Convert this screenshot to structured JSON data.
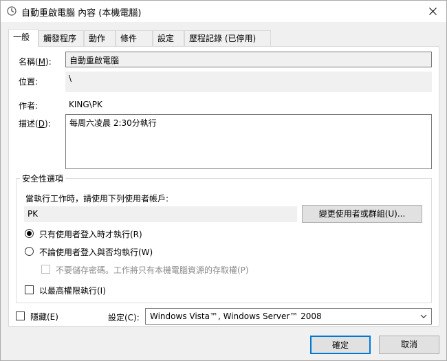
{
  "window": {
    "title": "自動重啟電腦 內容 (本機電腦)"
  },
  "tabs": [
    {
      "label": "一般",
      "accel": "",
      "active": true
    },
    {
      "label": "觸發程序",
      "active": false
    },
    {
      "label": "動作",
      "active": false
    },
    {
      "label": "條件",
      "active": false
    },
    {
      "label": "設定",
      "active": false
    },
    {
      "label": "歷程記錄 (已停用)",
      "active": false
    }
  ],
  "general": {
    "name_label": "名稱(",
    "name_accel": "M",
    "name_label_end": "):",
    "name_value": "自動重啟電腦",
    "location_label": "位置:",
    "location_value": "\\",
    "author_label": "作者:",
    "author_value": "KING\\PK",
    "desc_label": "描述(",
    "desc_accel": "D",
    "desc_label_end": "):",
    "desc_value": "每周六凌晨 2:30分執行"
  },
  "security": {
    "legend": "安全性選項",
    "run_as_label": "當執行工作時，請使用下列使用者帳戶:",
    "user_value": "PK",
    "change_user_button": "變更使用者或群組(U)...",
    "radio_logged_on": "只有使用者登入時才執行(R)",
    "radio_logged_on_selected": true,
    "radio_any": "不論使用者登入與否均執行(W)",
    "radio_any_selected": false,
    "no_store_password": "不要儲存密碼。工作將只有本機電腦資源的存取權(P)",
    "highest_priv": "以最高權限執行(I)"
  },
  "footer": {
    "hidden_label": "隱藏(E)",
    "config_label": "設定(C):",
    "config_value": "Windows Vista™, Windows Server™ 2008",
    "ok_button": "確定",
    "cancel_button": "取消"
  },
  "colors": {
    "accent": "#0078d7",
    "field_bg": "#f0f0f0"
  }
}
